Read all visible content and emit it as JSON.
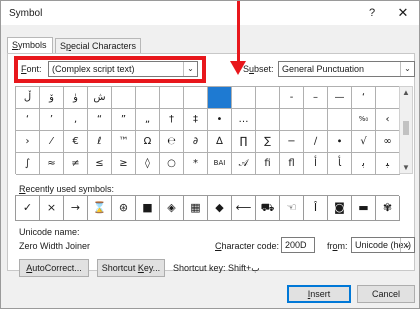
{
  "window": {
    "title": "Symbol",
    "help": "?",
    "close": "✕"
  },
  "tabs": [
    {
      "label": "Symbols",
      "mnemonic": "S",
      "rest": "ymbols"
    },
    {
      "label": "Special Characters",
      "mnemonic": "p",
      "pre": "S",
      "rest": "ecial Characters"
    }
  ],
  "font": {
    "mnemonic": "F",
    "rest": "ont:",
    "value": "(Complex script text)"
  },
  "subset": {
    "mnemonic": "u",
    "pre": "S",
    "rest": "bset:",
    "value": "General Punctuation"
  },
  "symbol_grid": [
    [
      "ڵ",
      "ۆ",
      "ۈ",
      "ش",
      "",
      "",
      "",
      "",
      "",
      "",
      "",
      "",
      "",
      "",
      "",
      ""
    ],
    [
      "‘",
      "’",
      "‚",
      "“",
      "”",
      "„",
      "†",
      "‡",
      "•",
      "…",
      "",
      "",
      "",
      "",
      "%₀",
      "‹"
    ],
    [
      "›",
      "⁄",
      "€",
      "ℓ",
      "™",
      "Ω",
      "℮",
      "∂",
      "∆",
      "∏",
      "∑",
      "−",
      "∕",
      "∙",
      "√",
      "∞"
    ],
    [
      "∫",
      "≈",
      "≠",
      "≤",
      "≥",
      "◊",
      "○",
      "*",
      "BAI",
      "𝒜",
      "ﬁ",
      "ﬂ",
      "ﺃ",
      "ﺄ",
      "ﺑ",
      "ﺒ"
    ]
  ],
  "selected_cell": {
    "row": 0,
    "col": 8
  },
  "dash_cells": {
    "row0": [
      "",
      "",
      "",
      "",
      "",
      "",
      "",
      "",
      "",
      "",
      "",
      "-",
      "–",
      "—",
      "‘",
      ""
    ]
  },
  "recent": {
    "label": "Recently used symbols:",
    "mnemonic": "R",
    "rest": "ecently used symbols:",
    "symbols": [
      "✓",
      "×",
      "→",
      "⌛",
      "⊛",
      "■",
      "◈",
      "▦",
      "◆",
      "⟵",
      "⛟",
      "☜",
      "Î",
      "◙",
      "▬",
      "✾"
    ]
  },
  "unicode": {
    "name_label": "Unicode name:",
    "name_value": "Zero Width Joiner"
  },
  "char_code": {
    "mnemonic": "C",
    "rest": "haracter code:",
    "value": "200D"
  },
  "from": {
    "pre": "fr",
    "mnemonic": "o",
    "rest": "m:",
    "value": "Unicode (hex)"
  },
  "buttons": {
    "autocorrect": {
      "mnemonic": "A",
      "rest": "utoCorrect..."
    },
    "shortcut_key": {
      "pre": "Shortcut ",
      "mnemonic": "K",
      "rest": "ey..."
    },
    "shortcut_text": "Shortcut key: Shift+ب",
    "insert": {
      "mnemonic": "I",
      "rest": "nsert"
    },
    "cancel": "Cancel"
  }
}
